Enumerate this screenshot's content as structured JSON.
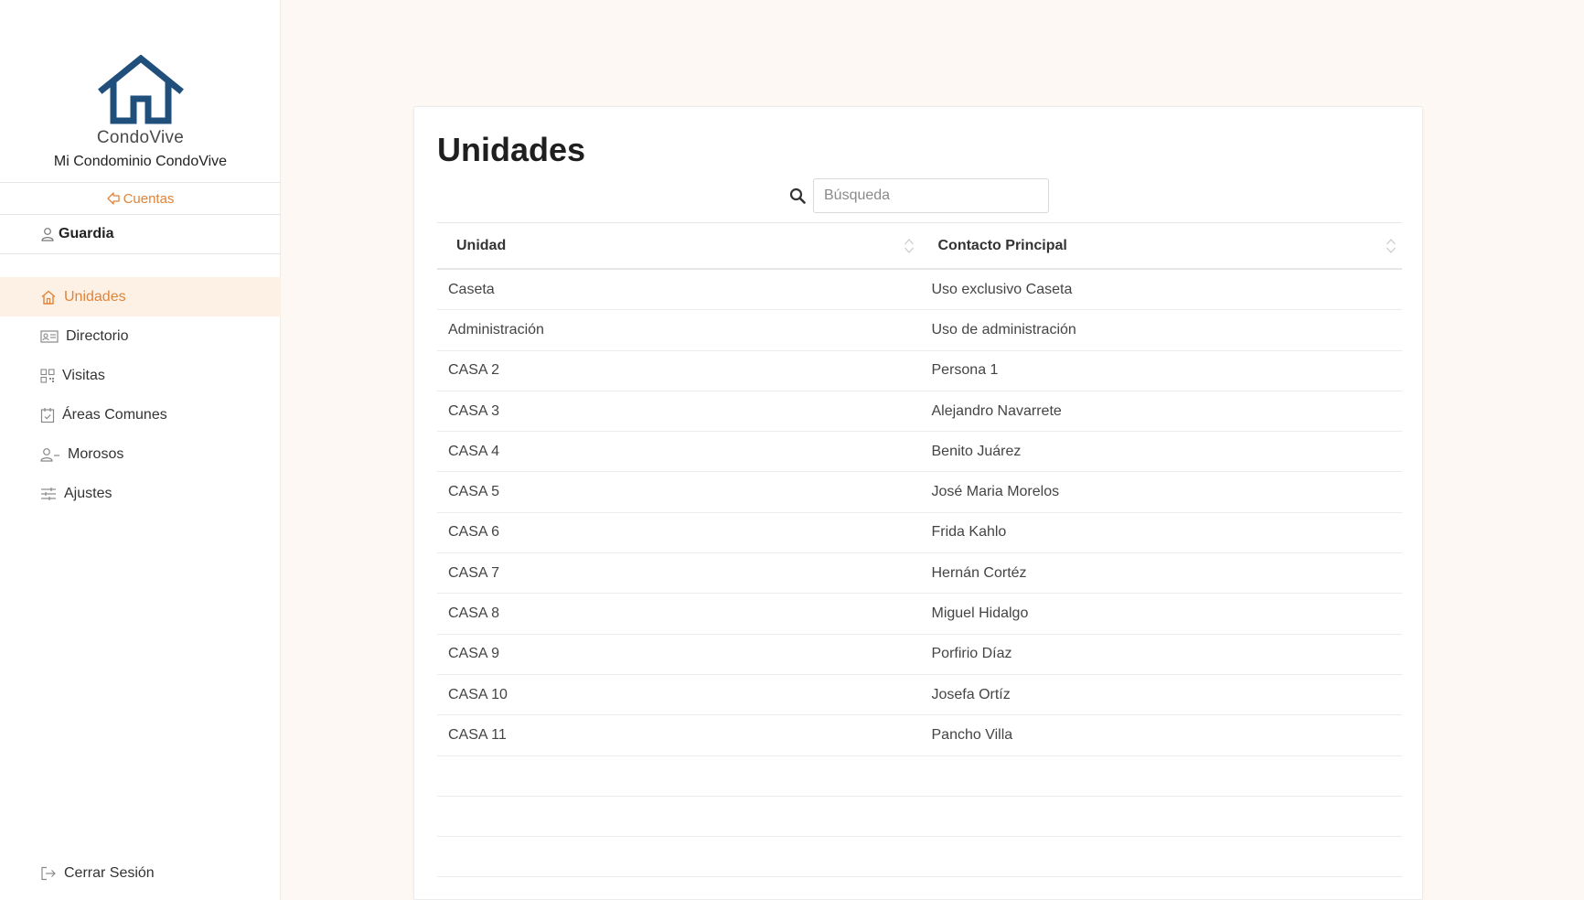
{
  "sidebar": {
    "brand": "CondoVive",
    "condo_name": "Mi Condominio CondoVive",
    "accounts_link": "Cuentas",
    "user_role": "Guardia",
    "nav_items": [
      {
        "label": "Unidades",
        "icon": "home-icon",
        "active": true
      },
      {
        "label": "Directorio",
        "icon": "id-card-icon",
        "active": false
      },
      {
        "label": "Visitas",
        "icon": "qr-code-icon",
        "active": false
      },
      {
        "label": "Áreas Comunes",
        "icon": "calendar-check-icon",
        "active": false
      },
      {
        "label": "Morosos",
        "icon": "user-minus-icon",
        "active": false
      },
      {
        "label": "Ajustes",
        "icon": "sliders-icon",
        "active": false
      }
    ],
    "logout": "Cerrar Sesión"
  },
  "colors": {
    "accent": "#e0843a",
    "logo_blue": "#1f4f7a",
    "background": "#fdf8f3"
  },
  "main": {
    "title": "Unidades",
    "search": {
      "placeholder": "Búsqueda",
      "value": ""
    },
    "table": {
      "columns": [
        "Unidad",
        "Contacto Principal"
      ],
      "rows": [
        [
          "Caseta",
          "Uso exclusivo Caseta"
        ],
        [
          "Administración",
          "Uso de administración"
        ],
        [
          "CASA 2",
          "Persona 1"
        ],
        [
          "CASA 3",
          "Alejandro Navarrete"
        ],
        [
          "CASA 4",
          "Benito Juárez"
        ],
        [
          "CASA 5",
          "José Maria Morelos"
        ],
        [
          "CASA 6",
          "Frida Kahlo"
        ],
        [
          "CASA 7",
          "Hernán Cortéz"
        ],
        [
          "CASA 8",
          "Miguel Hidalgo"
        ],
        [
          "CASA 9",
          "Porfirio Díaz"
        ],
        [
          "CASA 10",
          "Josefa Ortíz"
        ],
        [
          "CASA 11",
          "Pancho Villa"
        ]
      ]
    }
  }
}
